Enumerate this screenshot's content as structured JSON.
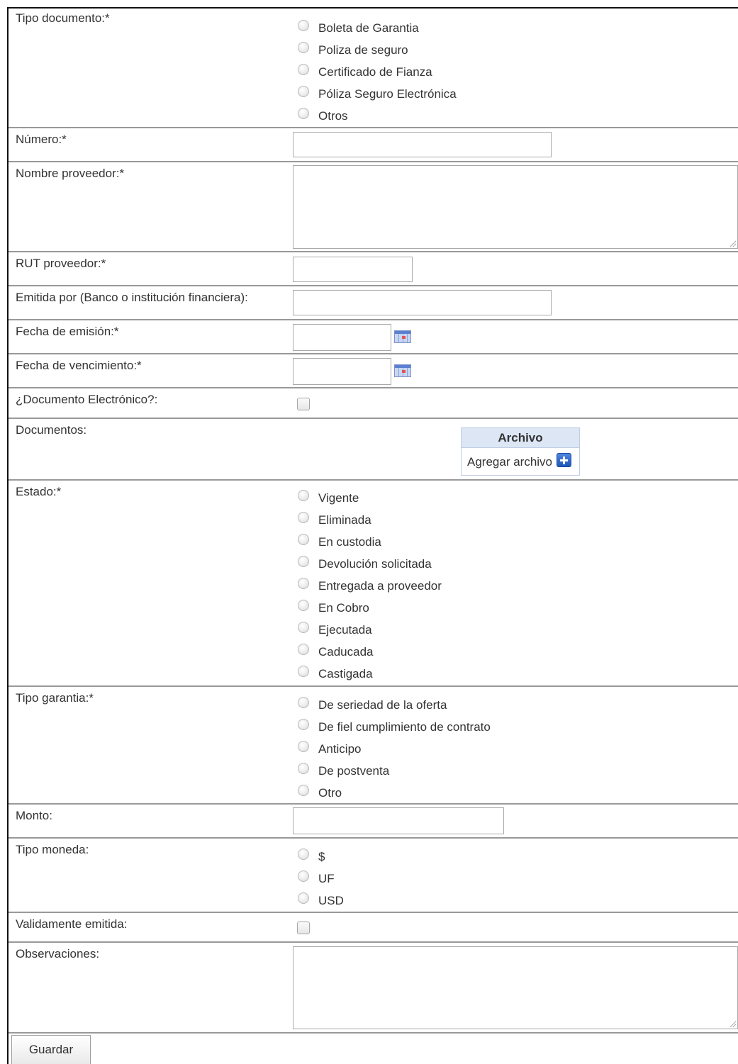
{
  "form": {
    "tipo_documento": {
      "label": "Tipo documento:*",
      "options": [
        "Boleta de Garantia",
        "Poliza de seguro",
        "Certificado de Fianza",
        "Póliza Seguro Electrónica",
        "Otros"
      ]
    },
    "numero": {
      "label": "Número:*",
      "value": ""
    },
    "nombre_proveedor": {
      "label": "Nombre proveedor:*",
      "value": ""
    },
    "rut_proveedor": {
      "label": "RUT proveedor:*",
      "value": ""
    },
    "emitida_por": {
      "label": "Emitida por (Banco o institución financiera):",
      "value": ""
    },
    "fecha_emision": {
      "label": "Fecha de emisión:*",
      "value": ""
    },
    "fecha_vencimiento": {
      "label": "Fecha de vencimiento:*",
      "value": ""
    },
    "documento_electronico": {
      "label": "¿Documento Electrónico?:",
      "checked": false
    },
    "documentos": {
      "label": "Documentos:",
      "table_header": "Archivo",
      "add_link": "Agregar archivo"
    },
    "estado": {
      "label": "Estado:*",
      "options": [
        "Vigente",
        "Eliminada",
        "En custodia",
        "Devolución solicitada",
        "Entregada a proveedor",
        "En Cobro",
        "Ejecutada",
        "Caducada",
        "Castigada"
      ]
    },
    "tipo_garantia": {
      "label": "Tipo garantia:*",
      "options": [
        "De seriedad de la oferta",
        "De fiel cumplimiento de contrato",
        "Anticipo",
        "De postventa",
        "Otro"
      ]
    },
    "monto": {
      "label": "Monto:",
      "value": ""
    },
    "tipo_moneda": {
      "label": "Tipo moneda:",
      "options": [
        "$",
        "UF",
        "USD"
      ]
    },
    "validamente_emitida": {
      "label": "Validamente emitida:",
      "checked": false
    },
    "observaciones": {
      "label": "Observaciones:",
      "value": ""
    }
  },
  "actions": {
    "save_label": "Guardar"
  }
}
